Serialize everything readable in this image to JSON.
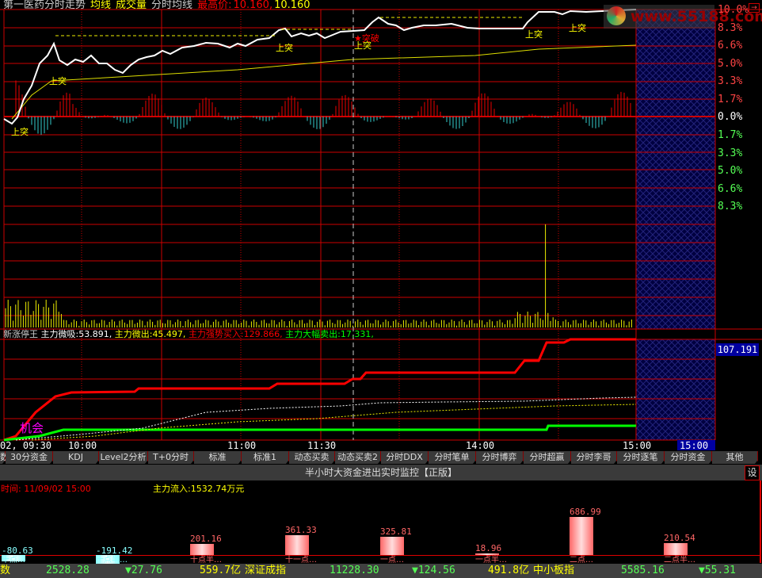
{
  "header": {
    "title": "第一医药分时走势",
    "avg": "均线",
    "vol": "成交量",
    "tavg": "分时均线",
    "high_label": "最高价:",
    "high1": "10.160,",
    "high2": "10.160"
  },
  "axis_up": [
    "10.0%",
    "8.3%",
    "6.6%",
    "5.0%",
    "3.3%",
    "1.7%",
    "0.0%"
  ],
  "axis_down": [
    "1.7%",
    "3.3%",
    "5.0%",
    "6.6%",
    "8.3%"
  ],
  "signals": {
    "breakout": "上突",
    "break_star": "★突破"
  },
  "watermark": "www.55188.com",
  "indicator": {
    "name": "新涨停王",
    "a_label": "主力微吸:",
    "a_val": "53.891,",
    "b_label": "主力微出:",
    "b_val": "45.497,",
    "c_label": "主力强势买入:",
    "c_val": "129.866,",
    "d_label": "主力大幅卖出:",
    "d_val": "17.331,",
    "right_val": "107.191",
    "opportunity": "机会"
  },
  "time_axis": [
    "02, 09:30",
    "10:00",
    "11:00",
    "11:30",
    "14:00",
    "15:00"
  ],
  "time_box": "15:00",
  "tabs": [
    "数",
    "30分资金",
    "KDJ",
    "Level2分析",
    "T+0分时",
    "标准",
    "标准1",
    "动态买卖",
    "动态买卖2",
    "分时DDX",
    "分时笔单",
    "分时博弈",
    "分时超赢",
    "分时李哥",
    "分时逐笔",
    "分时资金",
    "其他"
  ],
  "panel": {
    "title": "半小时大资金进出实时监控【正版】",
    "settings": "设",
    "time": "时间: 11/09/02 15:00",
    "inflow": "主力流入:1532.74万元"
  },
  "bars": [
    {
      "value": -80.63,
      "label": "十点…"
    },
    {
      "value": -191.42,
      "label": "十点半…"
    },
    {
      "value": 201.16,
      "label": "十点半…"
    },
    {
      "value": 361.33,
      "label": "十一点…"
    },
    {
      "value": 325.81,
      "label": "一点…"
    },
    {
      "value": 18.96,
      "label": "一点半…"
    },
    {
      "value": 686.99,
      "label": "二点…"
    },
    {
      "value": 210.54,
      "label": "二点半…"
    }
  ],
  "status": {
    "s0": "数",
    "sh_idx": "2528.28",
    "sh_chg": "▼27.76",
    "sh_amt": "559.7亿",
    "sz_name": "深证成指",
    "sz_idx": "11228.30",
    "sz_chg": "▼124.56",
    "sz_amt": "491.8亿",
    "zx_name": "中小板指",
    "zx_idx": "5585.16",
    "zx_chg": "▼55.31"
  }
}
